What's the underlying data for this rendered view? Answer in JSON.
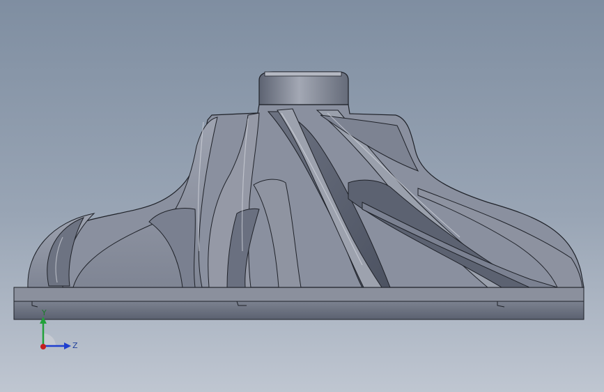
{
  "viewport": {
    "background_top": "#7f8ea1",
    "background_bottom": "#bfc6d1"
  },
  "model": {
    "name": "impeller",
    "color": "#8a909f",
    "shadow_color": "#4e5563",
    "highlight_color": "#c9ccd5"
  },
  "triad": {
    "y_label": "Y",
    "z_label": "Z",
    "y_color": "#22a13a",
    "z_color": "#1f3fcf",
    "x_color": "#c41f1f"
  }
}
